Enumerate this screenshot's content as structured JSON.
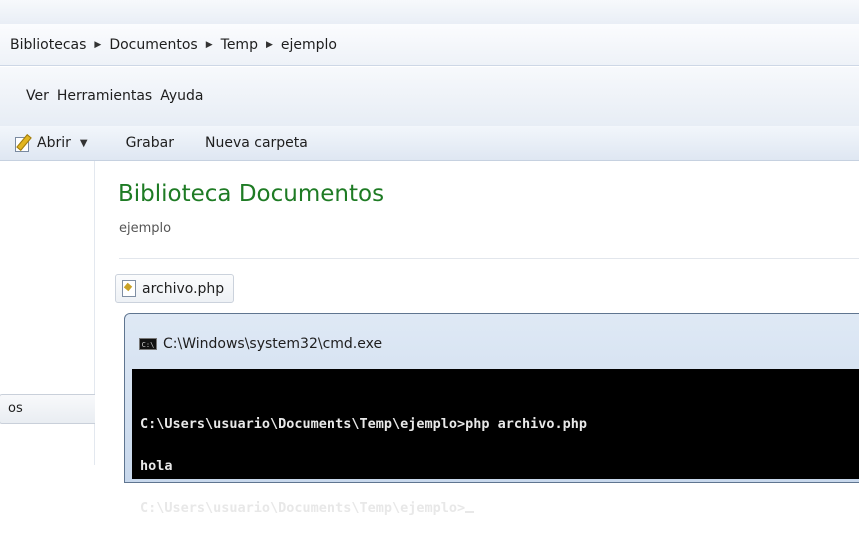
{
  "breadcrumb": [
    "Bibliotecas",
    "Documentos",
    "Temp",
    "ejemplo"
  ],
  "menu": [
    "Ver",
    "Herramientas",
    "Ayuda"
  ],
  "toolbar": {
    "open_label": "Abrir",
    "burn_label": "Grabar",
    "new_folder_label": "Nueva carpeta"
  },
  "navigation": {
    "partial_item_label": "os"
  },
  "library": {
    "title": "Biblioteca Documentos",
    "subtitle": "ejemplo"
  },
  "file": {
    "name": "archivo.php"
  },
  "cmd": {
    "title": "C:\\Windows\\system32\\cmd.exe",
    "icon_text": "C:\\",
    "lines": [
      "C:\\Users\\usuario\\Documents\\Temp\\ejemplo>php archivo.php",
      "hola",
      "C:\\Users\\usuario\\Documents\\Temp\\ejemplo>"
    ]
  },
  "colors": {
    "library_title": "#1e7b24",
    "console_bg": "#000000"
  }
}
